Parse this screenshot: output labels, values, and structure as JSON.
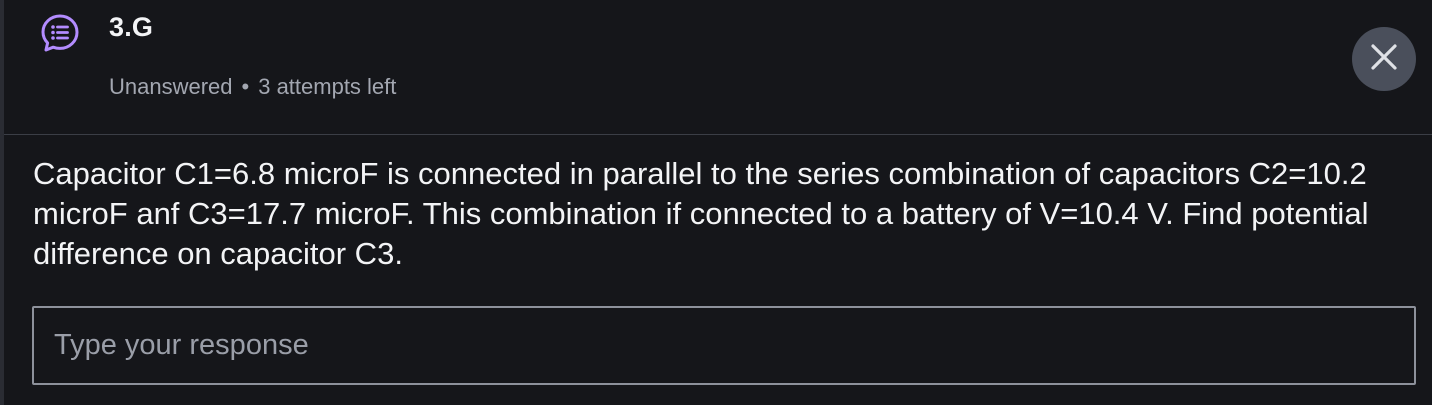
{
  "question": {
    "title": "3.G",
    "status": "Unanswered",
    "attempts": "3 attempts left",
    "separator": "•",
    "text": "Capacitor C1=6.8 microF is connected in parallel to the series combination of capacitors C2=10.2 microF anf C3=17.7 microF. This combination if connected to a battery of V=10.4 V. Find potential difference on capacitor C3."
  },
  "response": {
    "value": "",
    "placeholder": "Type your response"
  },
  "icons": {
    "question_icon": "chat-list-icon",
    "close_icon": "close-icon"
  },
  "colors": {
    "accent": "#b38cff",
    "background": "#15161a",
    "text": "#f3f4f6",
    "muted": "#a3a7b1",
    "close_button": "#4a4f5b"
  }
}
